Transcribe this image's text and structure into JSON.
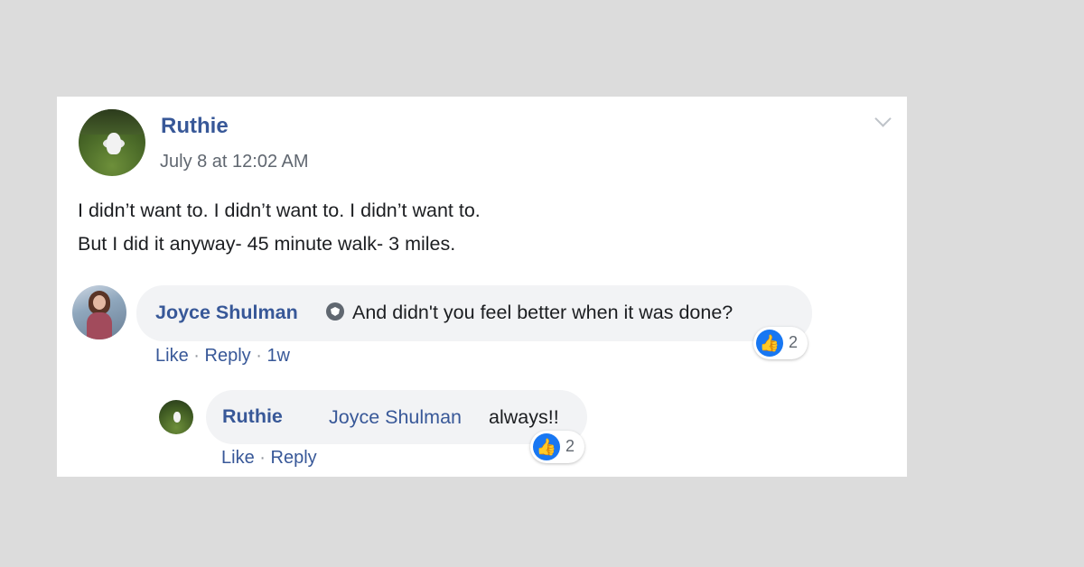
{
  "post": {
    "author": "Ruthie",
    "timestamp": "July 8 at 12:02 AM",
    "lines": [
      "I didn’t want to. I didn’t want to. I didn’t want to.",
      "But I did it anyway- 45 minute walk- 3 miles."
    ]
  },
  "comments": [
    {
      "author": "Joyce Shulman",
      "text": "And didn't you feel better when it was done?",
      "like_label": "Like",
      "reply_label": "Reply",
      "age": "1w",
      "reaction_count": "2"
    },
    {
      "author": "Ruthie",
      "mention": "Joyce Shulman",
      "text": "always!!",
      "like_label": "Like",
      "reply_label": "Reply",
      "reaction_count": "2"
    }
  ],
  "separator": "·",
  "colors": {
    "name_blue": "#385898",
    "like_blue": "#1877f2",
    "bubble_gray": "#f2f3f5",
    "meta_gray": "#606770"
  },
  "icons": {
    "options": "chevron-down-icon",
    "verified": "shield-badge-icon",
    "reaction": "thumbs-up-icon"
  }
}
